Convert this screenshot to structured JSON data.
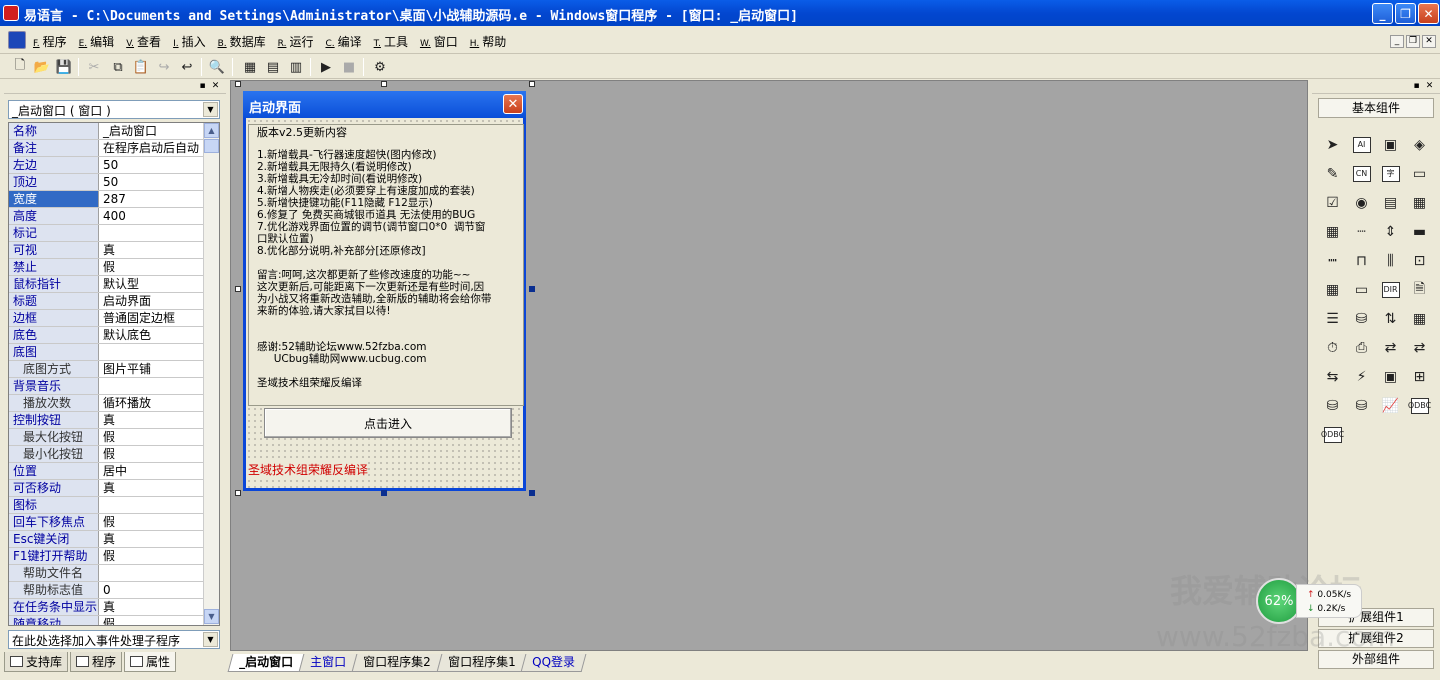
{
  "titlebar": {
    "title": "易语言 - C:\\Documents and Settings\\Administrator\\桌面\\小战辅助源码.e - Windows窗口程序 - [窗口: _启动窗口]",
    "minimize": "_",
    "restore": "❐",
    "close": "✕"
  },
  "menu": {
    "items": [
      {
        "acc": "F.",
        "label": "程序"
      },
      {
        "acc": "E.",
        "label": "编辑"
      },
      {
        "acc": "V.",
        "label": "查看"
      },
      {
        "acc": "I.",
        "label": "插入"
      },
      {
        "acc": "B.",
        "label": "数据库"
      },
      {
        "acc": "R.",
        "label": "运行"
      },
      {
        "acc": "C.",
        "label": "编译"
      },
      {
        "acc": "T.",
        "label": "工具"
      },
      {
        "acc": "W.",
        "label": "窗口"
      },
      {
        "acc": "H.",
        "label": "帮助"
      }
    ],
    "mdi_min": "_",
    "mdi_restore": "❐",
    "mdi_close": "✕"
  },
  "toolbar": {
    "icons": [
      "new-file-icon",
      "open-folder-icon",
      "save-icon",
      "cut-icon",
      "copy-icon",
      "paste-icon",
      "redo-icon",
      "undo-icon",
      "find-icon",
      "layout-1-icon",
      "layout-2-icon",
      "layout-3-icon",
      "run-icon",
      "stop-icon",
      "debug-icon"
    ]
  },
  "left_panel": {
    "object_select": "_启动窗口 ( 窗口 )",
    "properties": [
      {
        "name": "名称",
        "value": "_启动窗口",
        "sub": false
      },
      {
        "name": "备注",
        "value": "在程序启动后自动",
        "sub": false
      },
      {
        "name": "左边",
        "value": "50",
        "sub": false
      },
      {
        "name": "顶边",
        "value": "50",
        "sub": false
      },
      {
        "name": "宽度",
        "value": "287",
        "sub": false,
        "selected": true
      },
      {
        "name": "高度",
        "value": "400",
        "sub": false
      },
      {
        "name": "标记",
        "value": "",
        "sub": false
      },
      {
        "name": "可视",
        "value": "真",
        "sub": false
      },
      {
        "name": "禁止",
        "value": "假",
        "sub": false
      },
      {
        "name": "鼠标指针",
        "value": "默认型",
        "sub": false
      },
      {
        "name": "标题",
        "value": "启动界面",
        "sub": false
      },
      {
        "name": "边框",
        "value": "普通固定边框",
        "sub": false
      },
      {
        "name": "底色",
        "value": "默认底色",
        "sub": false
      },
      {
        "name": "底图",
        "value": "",
        "sub": false
      },
      {
        "name": "底图方式",
        "value": "图片平铺",
        "sub": true
      },
      {
        "name": "背景音乐",
        "value": "",
        "sub": false
      },
      {
        "name": "播放次数",
        "value": "循环播放",
        "sub": true
      },
      {
        "name": "控制按钮",
        "value": "真",
        "sub": false
      },
      {
        "name": "最大化按钮",
        "value": "假",
        "sub": true
      },
      {
        "name": "最小化按钮",
        "value": "假",
        "sub": true
      },
      {
        "name": "位置",
        "value": "居中",
        "sub": false
      },
      {
        "name": "可否移动",
        "value": "真",
        "sub": false
      },
      {
        "name": "图标",
        "value": "",
        "sub": false
      },
      {
        "name": "回车下移焦点",
        "value": "假",
        "sub": false
      },
      {
        "name": "Esc键关闭",
        "value": "真",
        "sub": false
      },
      {
        "name": "F1键打开帮助",
        "value": "假",
        "sub": false
      },
      {
        "name": "帮助文件名",
        "value": "",
        "sub": true
      },
      {
        "name": "帮助标志值",
        "value": "0",
        "sub": true
      },
      {
        "name": "在任务条中显示",
        "value": "真",
        "sub": false
      },
      {
        "name": "随意移动",
        "value": "假",
        "sub": false
      }
    ],
    "event_select": "在此处选择加入事件处理子程序",
    "tabs": [
      {
        "label": "支持库",
        "active": false
      },
      {
        "label": "程序",
        "active": false
      },
      {
        "label": "属性",
        "active": true
      }
    ]
  },
  "form": {
    "title": "启动界面",
    "notes_legend": "版本v2.5更新内容",
    "notes_text": "1.新增载具-飞行器速度超快(图内修改)\n2.新增载具无限持久(看说明修改)\n3.新增载具无冷却时间(看说明修改)\n4.新增人物疾走(必须要穿上有速度加成的套装)\n5.新增快捷键功能(F11隐藏 F12显示)\n6.修复了 免费买商城银币道具 无法使用的BUG\n7.优化游戏界面位置的调节(调节窗口0*0  调节窗\n口默认位置)\n8.优化部分说明,补充部分[还原修改]\n\n留言:呵呵,这次都更新了些修改速度的功能~~\n这次更新后,可能距离下一次更新还是有些时间,因\n为小战又将重新改造辅助,全新版的辅助将会给你带\n来新的体验,请大家拭目以待!\n\n\n感谢:52辅助论坛www.52fzba.com\n     UCbug辅助网www.ucbug.com\n\n圣域技术组荣耀反编译",
    "enter_button": "点击进入",
    "credit": "圣域技术组荣耀反编译"
  },
  "window_tabs": [
    {
      "label": "_启动窗口",
      "active": true,
      "link": false
    },
    {
      "label": "主窗口",
      "active": false,
      "link": true
    },
    {
      "label": "窗口程序集2",
      "active": false,
      "link": false
    },
    {
      "label": "窗口程序集1",
      "active": false,
      "link": false
    },
    {
      "label": "QQ登录",
      "active": false,
      "link": true
    }
  ],
  "right_panel": {
    "basic_group": "基本组件",
    "components": [
      "pointer-icon",
      "label-icon",
      "picture-box-icon",
      "shape-icon",
      "edit-box-icon",
      "text-icon",
      "font-icon",
      "line-icon",
      "checkbox-icon",
      "radio-icon",
      "list-icon",
      "grid-icon",
      "table-icon",
      "ruler-icon",
      "spinner-icon",
      "progress-icon",
      "h-ruler-icon",
      "tab-icon",
      "slider-icon",
      "frame-icon",
      "calendar-icon",
      "status-bar-icon",
      "dir-icon",
      "file-icon",
      "menu-icon",
      "db-icon",
      "split-icon",
      "panel-icon",
      "timer-icon",
      "printer-icon",
      "link-icon",
      "link-2-icon",
      "net-icon",
      "connect-icon",
      "view-icon",
      "tree-icon",
      "dbgrid-icon",
      "db-2-icon",
      "chart-icon",
      "odbc-icon",
      "odbc-2-icon"
    ],
    "component_text": {
      "label": "AI",
      "text": "CN",
      "font": "字",
      "dir": "DIR",
      "odbc": "ODBC"
    },
    "ext_group_1": "扩展组件1",
    "ext_group_2": "扩展组件2",
    "external_group": "外部组件"
  },
  "net_widget": {
    "percent": "62%",
    "up": "0.05K/s",
    "down": "0.2K/s"
  },
  "watermark": {
    "line1": "我爱辅助论坛",
    "line2": "www.52fzba.com"
  }
}
